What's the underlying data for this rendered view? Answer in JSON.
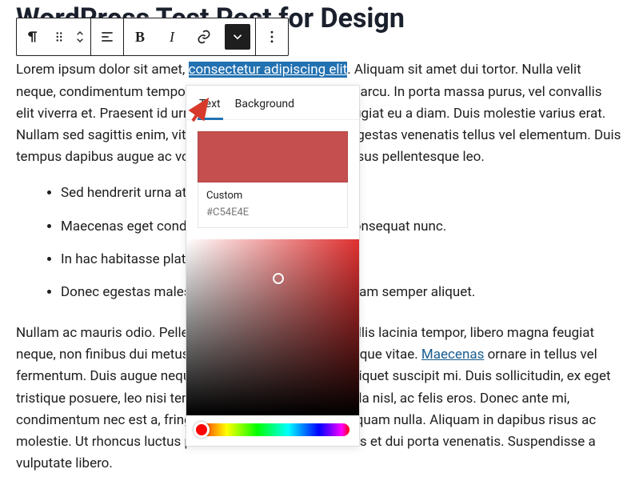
{
  "title": "WordPress Test Post for Design",
  "paragraph1_before": "Lorem ipsum dolor sit amet, ",
  "highlighted": "consectetur adipiscing elit",
  "paragraph1_after": ". Aliquam sit amet dui tortor. Nulla velit neque, condimentum tempor ligula ac, fringilla dignissim arcu. In porta massa purus, vel convallis elit viverra et. Praesent id urna sit amet elit accumsan feugiat eu a diam. Duis molestie varius erat. Nullam sed sagittis enim, vitae sagittis ipsum. Aliquam egestas venenatis tellus vel elementum. Duis tempus dapibus augue ac volutpat. Aliquam ac elit sed risus pellentesque leo.",
  "bullets": [
    "Sed hendrerit urna at mauris ullamcorper facilisis.",
    "Maecenas eget condimentum ligula, bibendum consequat nunc.",
    "In hac habitasse platea dictumst.",
    "Donec egestas malesuada nunc, at sollicitudin quam semper aliquet."
  ],
  "paragraph2_before": "Nullam ac mauris odio. Pellentesque in felis rhoncus, mollis lacinia tempor, libero magna feugiat neque, non finibus dui metus in dolor. Mauris a risus tristique vitae. ",
  "link_text": "Maecenas",
  "paragraph2_after": " ornare in tellus vel fermentum. Duis augue neque, sodales ac augue vitae, aliquet suscipit mi. Duis sollicitudin, ex eget tristique posuere, leo nisi tempor lorem, ac rutrum vehicula nisl, ac felis eros. Donec ante mi, condimentum nec est a, fringilla fringilla sem. Nam ut aliquam nulla. Aliquam in dapibus risus ac molestie. Ut rhoncus luctus pulvinar. Mauris dictum metus et dui porta venenatis. Suspendisse a vulputate libero.",
  "panel": {
    "tab_text": "Text",
    "tab_bg": "Background",
    "custom_label": "Custom",
    "hex": "#C54E4E"
  },
  "toolbar": {
    "bold": "B",
    "italic": "I"
  }
}
